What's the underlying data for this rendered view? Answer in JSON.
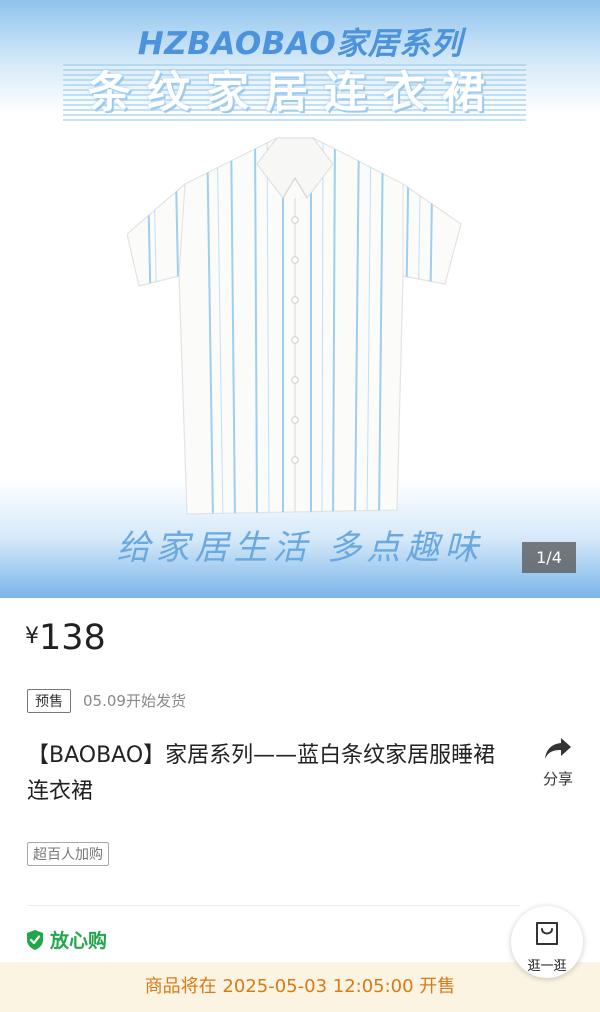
{
  "gallery": {
    "brand_title": "HZBAOBAO家居系列",
    "collection_title": "条纹家居连衣裙",
    "tagline": "给家居生活 多点趣味",
    "counter": "1/4"
  },
  "product": {
    "currency": "¥",
    "price": "138",
    "presale_tag": "预售",
    "ship_date": "05.09开始发货",
    "title": "【BAOBAO】家居系列——蓝白条纹家居服睡裙连衣裙",
    "share_label": "分享",
    "popularity_tag": "超百人加购",
    "assurance_label": "放心购",
    "stroll_label": "逛一逛",
    "sale_notice": "商品将在 2025-05-03 12:05:00 开售"
  },
  "colors": {
    "accent_green": "#22a64b",
    "notice_orange": "#d97a15",
    "stripe_blue": "#8ec7ec"
  },
  "icons": [
    "share-arrow-icon",
    "shield-check-icon",
    "shopping-bag-icon"
  ]
}
